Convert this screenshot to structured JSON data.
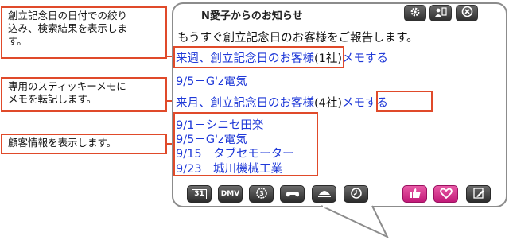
{
  "callouts": [
    {
      "text": "創立記念日の日付での絞り\n込み、検索結果を表示しま\nす。"
    },
    {
      "text": "専用のスティッキーメモに\nメモを転記します。"
    },
    {
      "text": "顧客情報を表示します。"
    }
  ],
  "widget": {
    "title": "N愛子からのお知らせ",
    "message": "もうすぐ創立記念日のお客様をご報告します。",
    "week_link": "来週、創立記念日のお客様",
    "week_count": "(1社)",
    "week_memo": "メモする",
    "week_item": "9/5－G'z電気",
    "month_link": "来月、創立記念日のお客様",
    "month_count": "(4社)",
    "month_memo": "メモする",
    "month_items": [
      "9/1－シニセ田楽",
      "9/5－G'z電気",
      "9/15－タブセモーター",
      "9/23－城川機械工業"
    ]
  },
  "toolbar": {
    "calendar_label": "31",
    "dmv_label": "DMV"
  },
  "colors": {
    "accent": "#e04a2a",
    "link": "#1f39d8",
    "pink": "#d12b88"
  }
}
